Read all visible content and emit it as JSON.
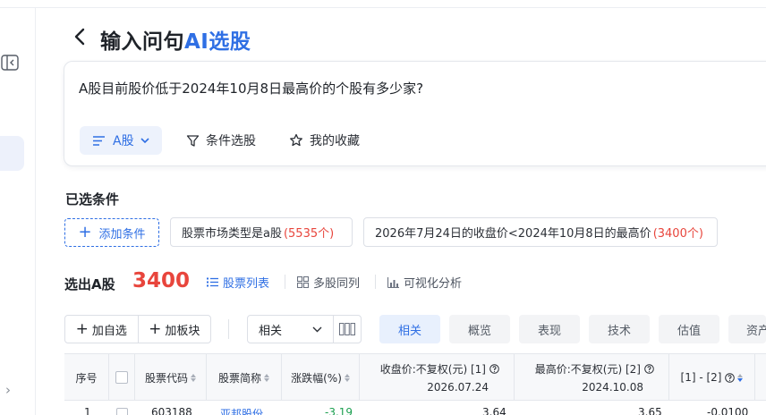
{
  "header": {
    "title_prefix": "输入问句",
    "title_ai": "AI选股"
  },
  "query": {
    "text": "A股目前股价低于2024年10月8日最高价的个股有多少家?",
    "market_label": "A股",
    "condition_select_label": "条件选股",
    "favorites_label": "我的收藏"
  },
  "conditions": {
    "heading": "已选条件",
    "add_label": "添加条件",
    "tags": [
      {
        "text": "股票市场类型是a股",
        "count": "(5535个)"
      },
      {
        "text": "2026年7月24日的收盘价<2024年10月8日的最高价",
        "count": "(3400个)"
      }
    ]
  },
  "results": {
    "label": "选出A股",
    "count": "3400",
    "views": [
      "股票列表",
      "多股同列",
      "可视化分析"
    ]
  },
  "toolbar": {
    "add_watchlist": "加自选",
    "add_sector": "加板块",
    "sort_value": "相关",
    "category_tabs": [
      "相关",
      "概览",
      "表现",
      "技术",
      "估值",
      "资产"
    ]
  },
  "table": {
    "columns": {
      "index": "序号",
      "code": "股票代码",
      "name": "股票简称",
      "change": "涨跌幅(%)",
      "close": "收盘价:不复权(元) [1]",
      "close_date": "2026.07.24",
      "high": "最高价:不复权(元) [2]",
      "high_date": "2024.10.08",
      "diff": "[1] - [2]"
    },
    "rows": [
      {
        "index": "1",
        "code": "603188",
        "name": "亚邦股份",
        "change": "-3.19",
        "close": "3.64",
        "high": "3.65",
        "diff": "-0.0100"
      }
    ]
  },
  "colors": {
    "accent": "#2f6fe4",
    "highlight_red": "#e8453c",
    "down_green": "#1a9f4f"
  }
}
